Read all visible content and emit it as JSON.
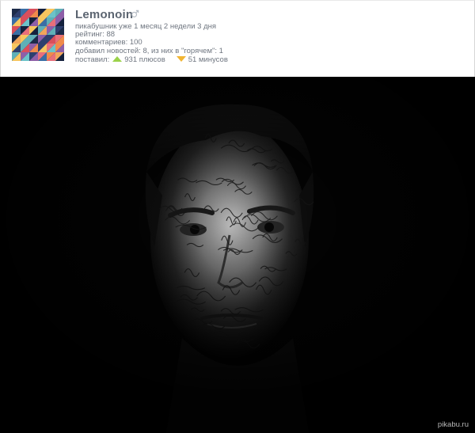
{
  "profile": {
    "username": "Lemonoin",
    "member_since": "пикабушник уже 1 месяц 2 недели 3 дня",
    "rating": "рейтинг: 88",
    "comments": "комментариев: 100",
    "posts": "добавил новостей: 8, из них в \"горячем\": 1",
    "votes_label": "поставил:",
    "pluses": "931 плюсов",
    "minuses": "51 минусов",
    "icons": [
      "gender-male-icon",
      "upvote-triangle-icon",
      "downvote-triangle-icon"
    ],
    "colors": {
      "plus": "#9bd24a",
      "minus": "#f1b533",
      "text": "#6f7680"
    }
  },
  "post": {
    "image_description_icon": "portrait-photo",
    "watermark": "pikabu.ru"
  }
}
